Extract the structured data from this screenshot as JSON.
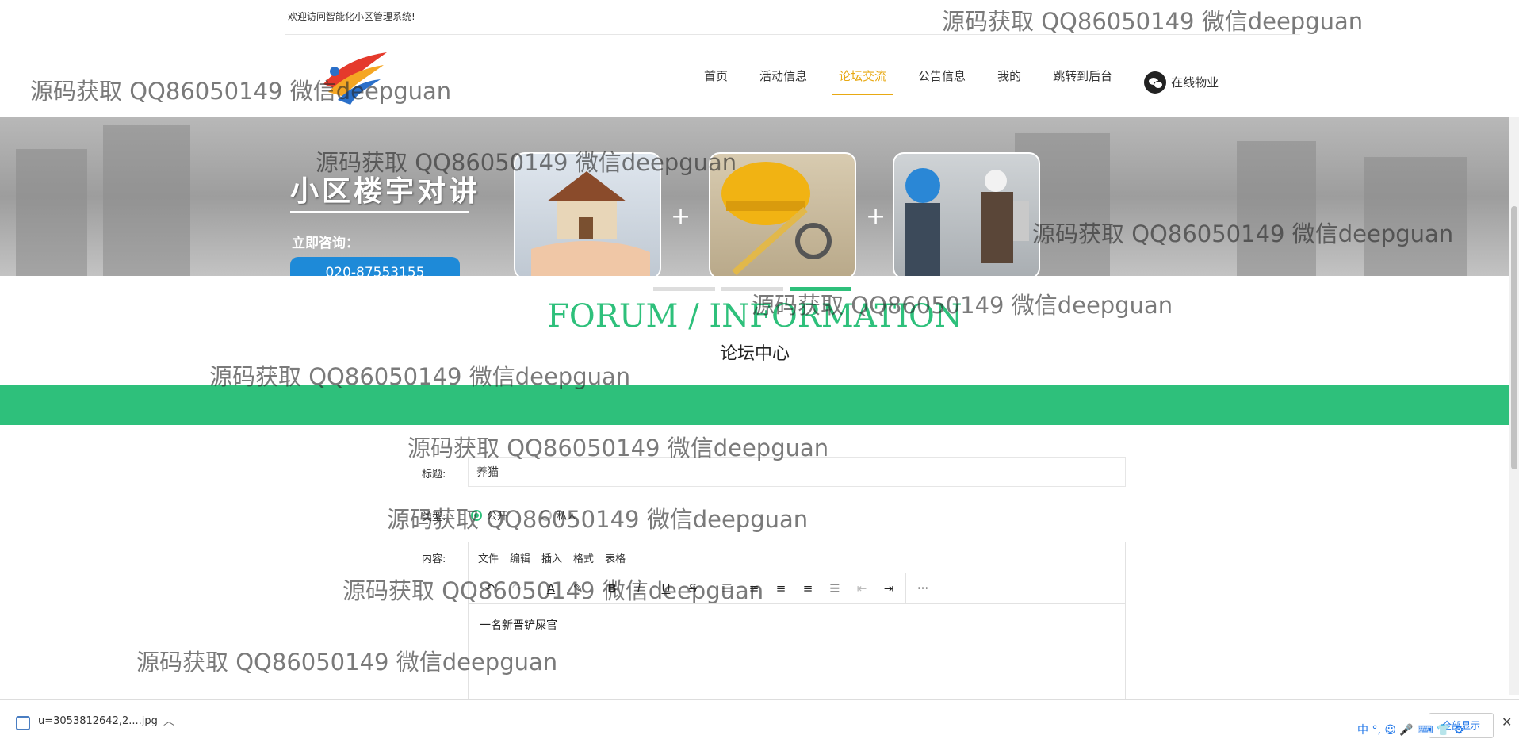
{
  "header": {
    "welcome": "欢迎访问智能化小区管理系统!",
    "nav": [
      "首页",
      "活动信息",
      "论坛交流",
      "公告信息",
      "我的",
      "跳转到后台"
    ],
    "active_index": 2,
    "service_label": "在线物业"
  },
  "banner": {
    "title": "小区楼宇对讲",
    "consult": "立即咨询：",
    "phone": "020-87553155",
    "plus": "+"
  },
  "forum": {
    "title_en": "FORUM / INFORMATION",
    "title_zh": "论坛中心"
  },
  "form": {
    "title_label": "标题:",
    "title_value": "养猫",
    "type_label": "类型:",
    "type_options": [
      "公开",
      "私人"
    ],
    "content_label": "内容:",
    "editor_menu": [
      "文件",
      "编辑",
      "插入",
      "格式",
      "表格"
    ],
    "content_text": "一名新晋铲屎官"
  },
  "download": {
    "filename": "u=3053812642,2....jpg",
    "show_all": "全部显示"
  },
  "ime": "中 °, ☺ 🎤 ⌨ 👕 ⚙",
  "watermark": "源码获取 QQ86050149 微信deepguan",
  "colors": {
    "accent": "#2ec07b",
    "nav_active": "#e8a913"
  }
}
